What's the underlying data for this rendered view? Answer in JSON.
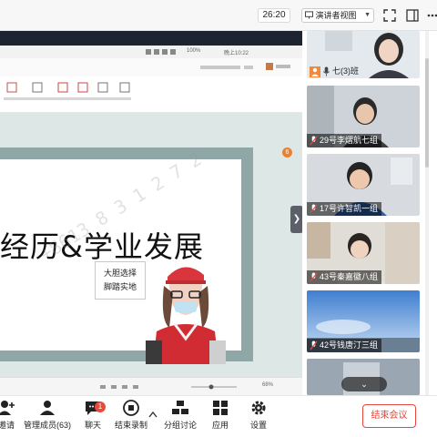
{
  "topbar": {
    "timer": "26:20",
    "presenter_view": "演讲者视图"
  },
  "slide": {
    "title": "经历&学业发展",
    "watermark": "+8613 8 3 1 2 7 2",
    "bubble_line1": "大胆选择",
    "bubble_line2": "脚踏实地"
  },
  "ppt": {
    "status_time": "晚上10:22",
    "status_battery": "100%",
    "zoom": "68%",
    "unread": "6"
  },
  "participants": [
    {
      "name": "七(3)班",
      "image": "girl-with-headset"
    },
    {
      "name": "29号李熠航七组",
      "image": "boy-in-room"
    },
    {
      "name": "17号许智凯一组",
      "image": "boy-blue-jacket"
    },
    {
      "name": "43号秦嘉徽八组",
      "image": "girl-studying"
    },
    {
      "name": "42号钱唐汀三组",
      "image": "sky-scene"
    }
  ],
  "toolbar": {
    "invite_label": "邀请",
    "members_label": "管理成员(63)",
    "chat_label": "聊天",
    "chat_badge": "1",
    "record_label": "结束录制",
    "breakout_label": "分组讨论",
    "apps_label": "应用",
    "settings_label": "设置",
    "end_meeting_label": "结束会议"
  },
  "colors": {
    "accent_red": "#e6473d",
    "badge_red": "#e74a3b",
    "slide_frame": "#8fa7a6"
  }
}
